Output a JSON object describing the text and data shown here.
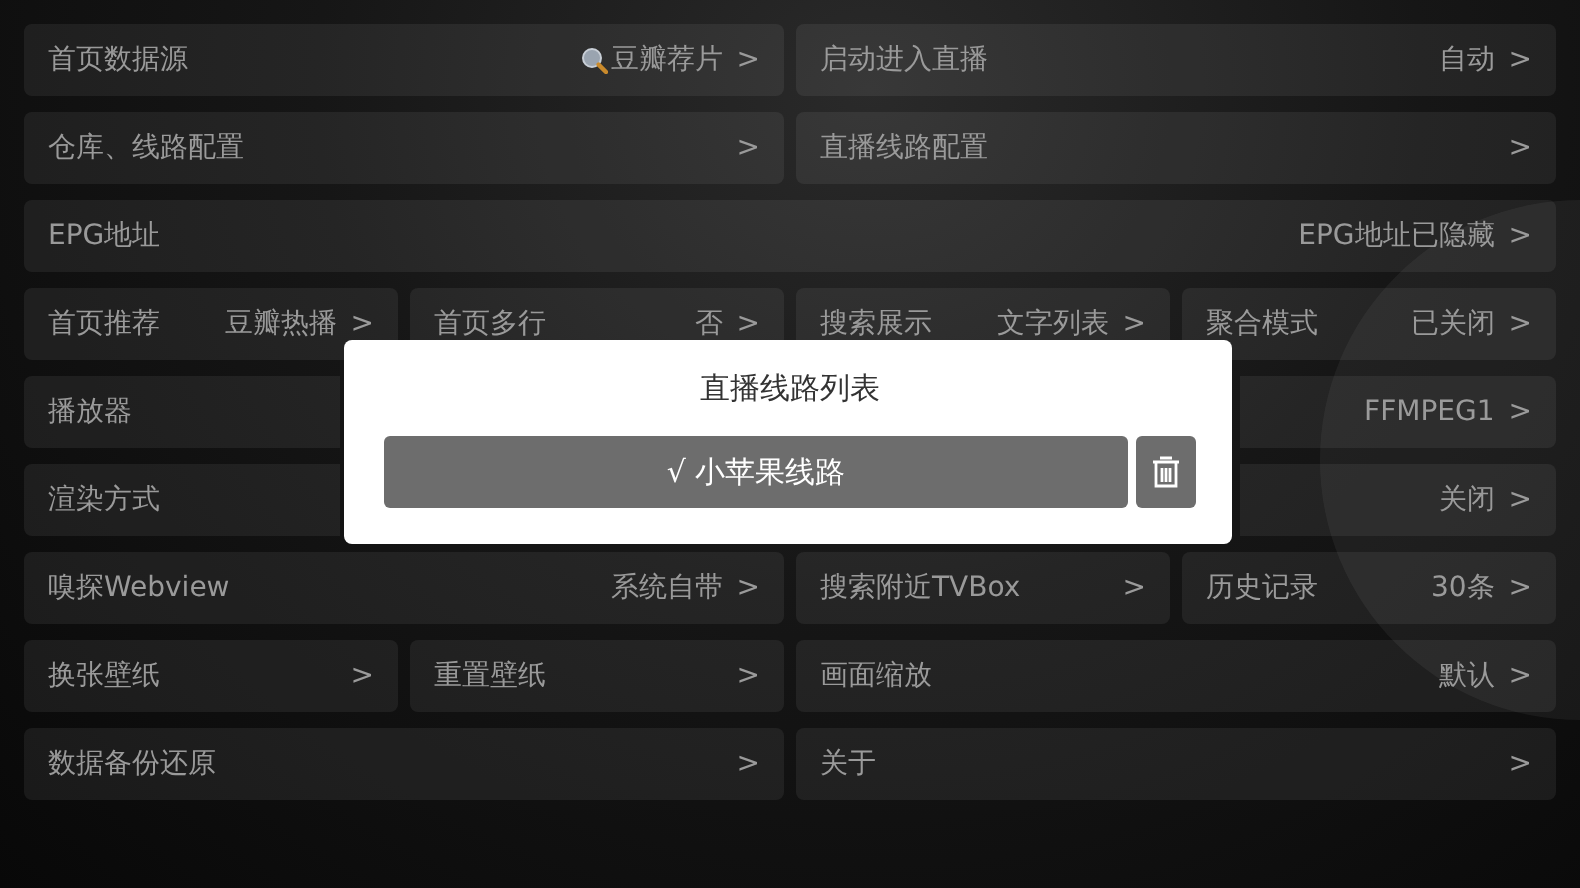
{
  "settings_rows": [
    {
      "groups": [
        {
          "items": [
            {
              "kind": "with-icon",
              "label": "首页数据源",
              "value": "豆瓣荐片",
              "arrow": ">"
            }
          ]
        },
        {
          "items": [
            {
              "kind": "plain",
              "label": "启动进入直播",
              "value": "自动",
              "arrow": ">"
            }
          ]
        }
      ]
    },
    {
      "groups": [
        {
          "items": [
            {
              "kind": "plain",
              "label": "仓库、线路配置",
              "arrow": ">"
            }
          ]
        },
        {
          "items": [
            {
              "kind": "plain",
              "label": "直播线路配置",
              "arrow": ">"
            }
          ]
        }
      ]
    },
    {
      "groups": [
        {
          "items": [
            {
              "kind": "plain",
              "label": "EPG地址",
              "value": "EPG地址已隐藏",
              "arrow": ">"
            }
          ]
        }
      ]
    },
    {
      "groups": [
        {
          "items": [
            {
              "kind": "plain",
              "label": "首页推荐",
              "value": "豆瓣热播",
              "arrow": ">"
            },
            {
              "kind": "plain",
              "label": "首页多行",
              "value": "否",
              "arrow": ">"
            }
          ]
        },
        {
          "items": [
            {
              "kind": "plain",
              "label": "搜索展示",
              "value": "文字列表",
              "arrow": ">"
            },
            {
              "kind": "plain",
              "label": "聚合模式",
              "value": "已关闭",
              "arrow": ">"
            }
          ]
        }
      ]
    },
    {
      "groups": [
        {
          "items": [
            {
              "kind": "plain",
              "label": "播放器"
            }
          ]
        },
        {
          "items": [
            {
              "kind": "plain",
              "value": "FFMPEG1",
              "arrow": ">"
            }
          ]
        }
      ]
    },
    {
      "groups": [
        {
          "items": [
            {
              "kind": "plain",
              "label": "渲染方式"
            }
          ]
        },
        {
          "items": [
            {
              "kind": "plain",
              "value": "关闭",
              "arrow": ">"
            }
          ]
        }
      ]
    },
    {
      "groups": [
        {
          "items": [
            {
              "kind": "plain",
              "label": "嗅探Webview",
              "value": "系统自带",
              "arrow": ">"
            }
          ]
        },
        {
          "items": [
            {
              "kind": "plain",
              "label": "搜索附近TVBox",
              "arrow": ">"
            },
            {
              "kind": "plain",
              "label": "历史记录",
              "value": "30条",
              "arrow": ">"
            }
          ]
        }
      ]
    },
    {
      "groups": [
        {
          "items": [
            {
              "kind": "plain",
              "label": "换张壁纸",
              "arrow": ">"
            },
            {
              "kind": "plain",
              "label": "重置壁纸",
              "arrow": ">"
            }
          ]
        },
        {
          "items": [
            {
              "kind": "plain",
              "label": "画面缩放",
              "value": "默认",
              "arrow": ">"
            }
          ]
        }
      ]
    },
    {
      "groups": [
        {
          "items": [
            {
              "kind": "plain",
              "label": "数据备份还原",
              "arrow": ">"
            }
          ]
        },
        {
          "items": [
            {
              "kind": "plain",
              "label": "关于",
              "arrow": ">"
            }
          ]
        }
      ]
    }
  ],
  "dialog": {
    "title": "直播线路列表",
    "lines": [
      {
        "name": "√ 小苹果线路",
        "selected": true
      }
    ]
  }
}
